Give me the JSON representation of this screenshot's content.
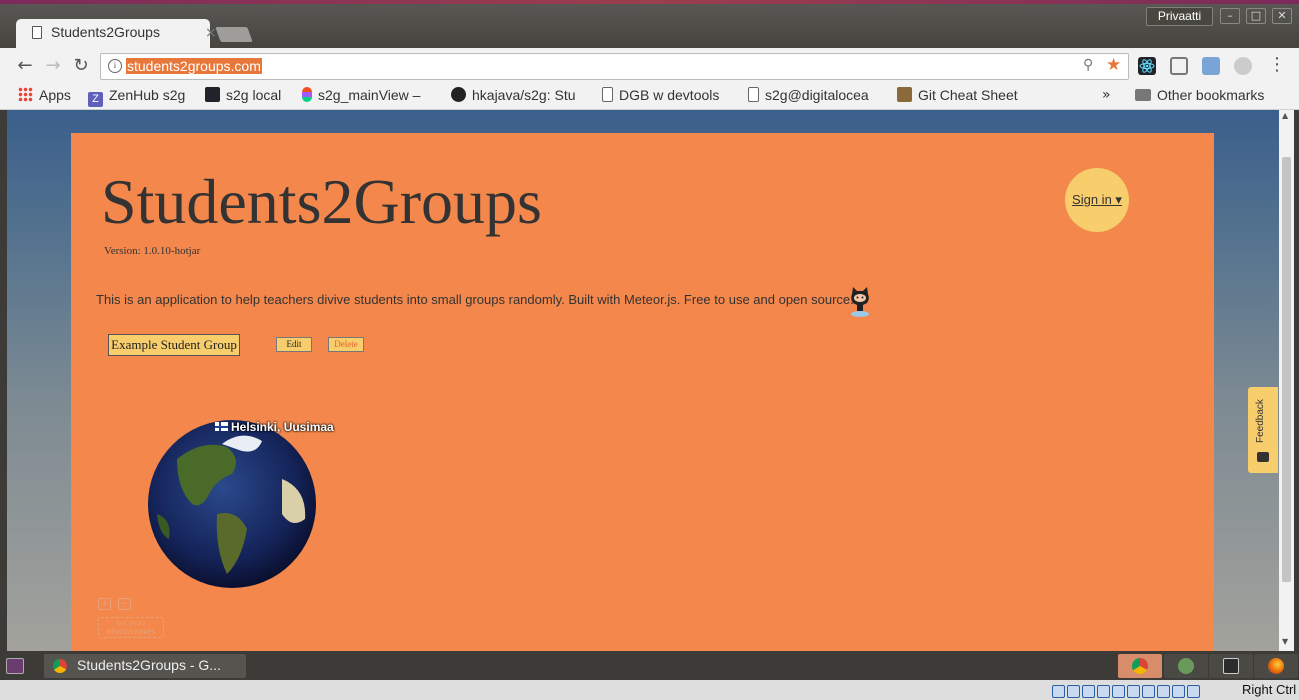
{
  "window": {
    "tab_title": "Students2Groups",
    "tab_close": "×",
    "profile_name": "Privaatti",
    "minimize": "–",
    "maximize": "□",
    "close": "✕"
  },
  "toolbar": {
    "back": "←",
    "forward": "→",
    "reload": "↻",
    "url": "students2groups.com",
    "info": "i",
    "zoom": "⚲",
    "star": "★",
    "menu": "⋮"
  },
  "bookmarks": {
    "items": [
      {
        "label": "Apps",
        "icon": "apps-grid-icon"
      },
      {
        "label": "ZenHub s2g",
        "icon": "zenhub-icon"
      },
      {
        "label": "s2g local",
        "icon": "react-icon"
      },
      {
        "label": "s2g_mainView –",
        "icon": "figma-icon"
      },
      {
        "label": "hkajava/s2g: Stu",
        "icon": "github-icon"
      },
      {
        "label": "DGB w devtools",
        "icon": "page-icon"
      },
      {
        "label": "s2g@digitalocea",
        "icon": "page-icon"
      },
      {
        "label": "Git Cheat Sheet",
        "icon": "git-icon"
      }
    ],
    "overflow": "»",
    "other": "Other bookmarks"
  },
  "page": {
    "title": "Students2Groups",
    "version": "Version: 1.0.10-hotjar",
    "signin": "Sign in ▾",
    "description": "This is an application to help teachers divive students into small groups randomly. Built with Meteor.js. Free to use and open source.",
    "group_button": "Example Student Group",
    "edit": "Edit",
    "delete": "Delete",
    "globe_location": "Helsinki, Uusimaa",
    "zoom_in": "+",
    "zoom_out": "−",
    "revolver_line1": "Get yours",
    "revolver_line2": "REVOLVERMAPS",
    "feedback": "Feedback"
  },
  "taskbar": {
    "window_label": "Students2Groups - G...",
    "right_ctrl": "Right Ctrl"
  },
  "colors": {
    "card": "#f4874b",
    "accent": "#f8cd6b",
    "url_highlight": "#e8773a"
  }
}
